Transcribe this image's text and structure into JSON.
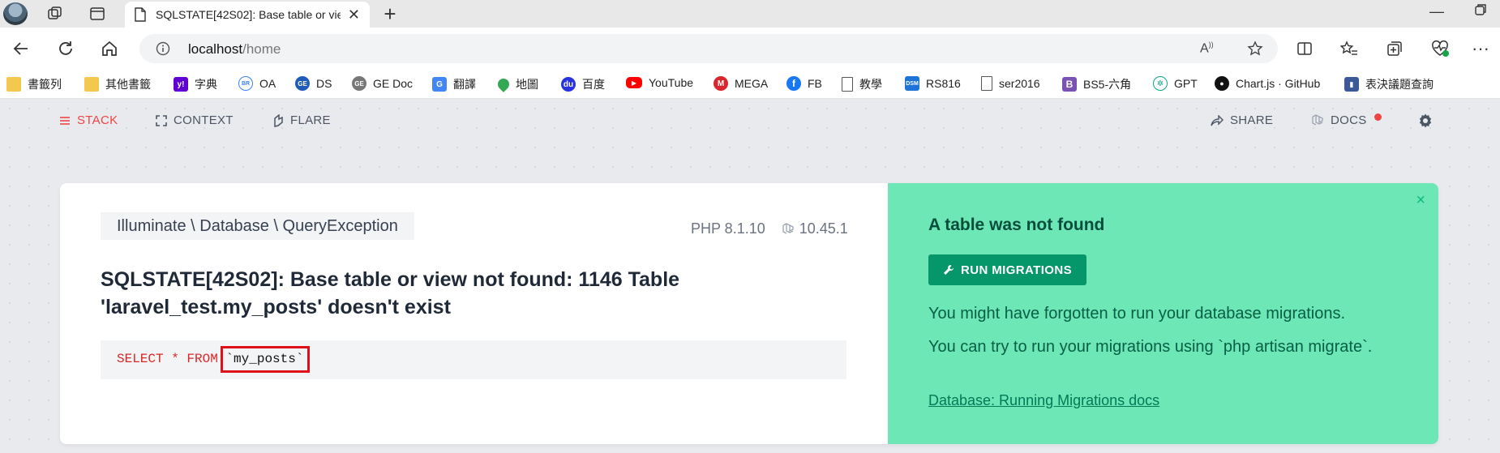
{
  "browser": {
    "tab_title": "SQLSTATE[42S02]: Base table or view not found: 1146 Table 'laravel_test.my_posts' doesn't exist",
    "url_host": "localhost",
    "url_path": "/home"
  },
  "bookmarks": [
    {
      "label": "書籤列",
      "icon": "folder-icon",
      "color": "#f2c94c"
    },
    {
      "label": "其他書籤",
      "icon": "folder-icon",
      "color": "#f2c94c"
    },
    {
      "label": "字典",
      "icon": "yahoo-icon",
      "color": "#5f01d1"
    },
    {
      "label": "OA",
      "icon": "cloud-icon",
      "color": "#3b82f6"
    },
    {
      "label": "DS",
      "icon": "ge-icon",
      "color": "#1e5bb8"
    },
    {
      "label": "GE Doc",
      "icon": "ge-icon",
      "color": "#777777"
    },
    {
      "label": "翻譯",
      "icon": "translate-icon",
      "color": "#4285f4"
    },
    {
      "label": "地圖",
      "icon": "maps-icon",
      "color": "#34a853"
    },
    {
      "label": "百度",
      "icon": "baidu-icon",
      "color": "#2932e1"
    },
    {
      "label": "YouTube",
      "icon": "youtube-icon",
      "color": "#ff0000"
    },
    {
      "label": "MEGA",
      "icon": "mega-icon",
      "color": "#d9272e"
    },
    {
      "label": "FB",
      "icon": "facebook-icon",
      "color": "#1877f2"
    },
    {
      "label": "教學",
      "icon": "page-icon",
      "color": "#555555"
    },
    {
      "label": "RS816",
      "icon": "dsm-icon",
      "color": "#1e73d8"
    },
    {
      "label": "ser2016",
      "icon": "page-icon",
      "color": "#555555"
    },
    {
      "label": "BS5-六角",
      "icon": "bootstrap-icon",
      "color": "#7952b3"
    },
    {
      "label": "GPT",
      "icon": "openai-icon",
      "color": "#10a37f"
    },
    {
      "label": "Chart.js · GitHub",
      "icon": "github-icon",
      "color": "#111111"
    },
    {
      "label": "表決議題查詢",
      "icon": "gov-icon",
      "color": "#3b5998"
    }
  ],
  "ignition_nav": {
    "stack": "STACK",
    "context": "CONTEXT",
    "flare": "FLARE",
    "share": "SHARE",
    "docs": "DOCS"
  },
  "error": {
    "exception_class": "Illuminate \\ Database \\ QueryException",
    "php_version": "PHP 8.1.10",
    "laravel_version": "10.45.1",
    "message": "SQLSTATE[42S02]: Base table or view not found: 1146 Table 'laravel_test.my_posts' doesn't exist",
    "sql_keywords": "SELECT * FROM",
    "sql_table": "`my_posts`"
  },
  "solution": {
    "title": "A table was not found",
    "button": "RUN MIGRATIONS",
    "line1": "You might have forgotten to run your database migrations.",
    "line2": "You can try to run your migrations using `php artisan migrate`.",
    "link": "Database: Running Migrations docs",
    "close": "×"
  },
  "colors": {
    "accent_red": "#ef4444",
    "solution_bg": "#6ee7b7",
    "button_green": "#059669"
  }
}
